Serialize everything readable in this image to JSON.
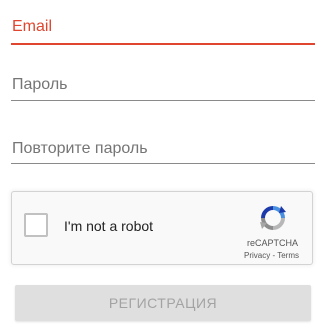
{
  "form": {
    "email": {
      "label": "Email",
      "value": "",
      "state": "focused",
      "accent_color": "#e0452f"
    },
    "password": {
      "label": "Пароль",
      "value": ""
    },
    "password_repeat": {
      "label": "Повторите пароль",
      "value": ""
    },
    "captcha": {
      "checkbox_label": "I'm not a robot",
      "checked": false,
      "brand": "reCAPTCHA",
      "privacy_link": "Privacy",
      "separator": " - ",
      "terms_link": "Terms",
      "logo_icon": "recaptcha-logo-icon"
    },
    "submit_button": {
      "label": "РЕГИСТРАЦИЯ",
      "enabled": false
    }
  }
}
